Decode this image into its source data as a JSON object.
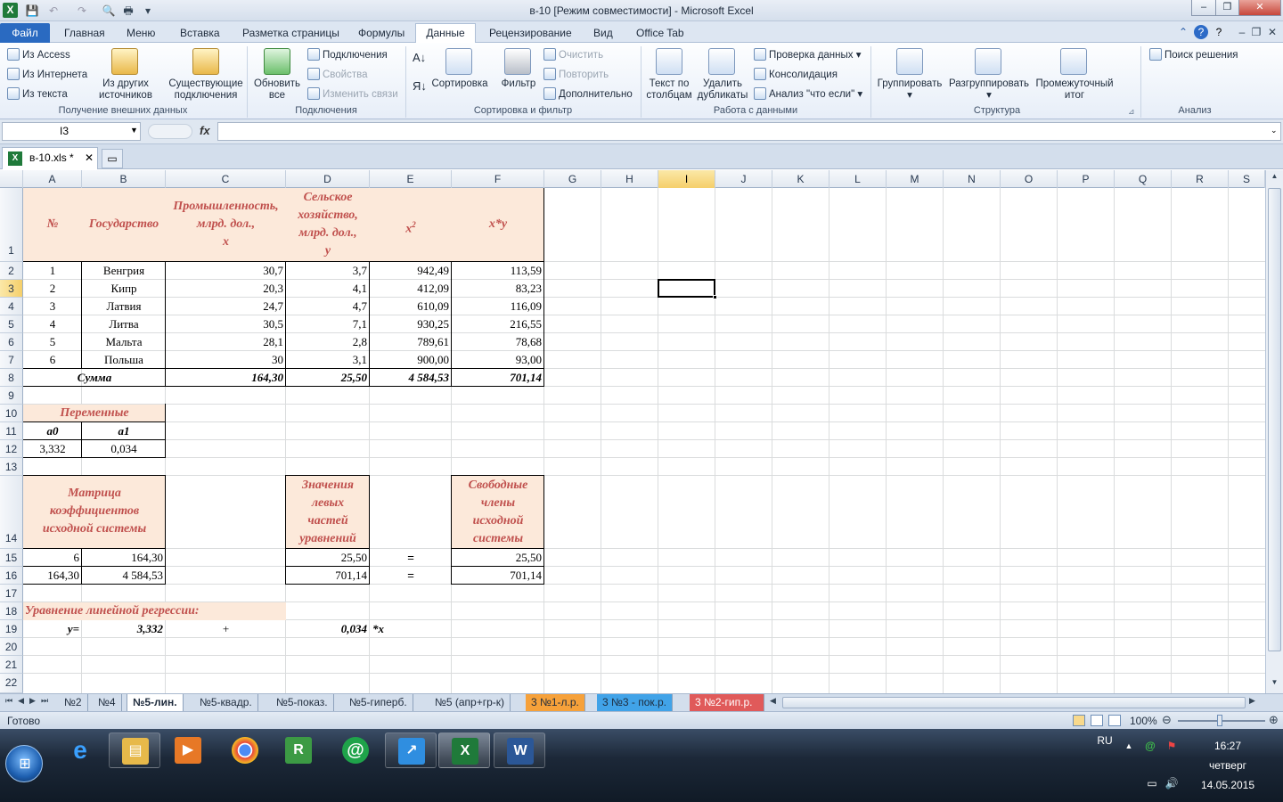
{
  "window": {
    "title": "в-10  [Режим совместимости]  -  Microsoft Excel",
    "minimize": "–",
    "restore": "❐",
    "close": "✕"
  },
  "menu_tabs": [
    "Файл",
    "Главная",
    "Меню",
    "Вставка",
    "Разметка страницы",
    "Формулы",
    "Данные",
    "Рецензирование",
    "Вид",
    "Office Tab"
  ],
  "ribbon": {
    "get_external": {
      "from_access": "Из Access",
      "from_web": "Из Интернета",
      "from_text": "Из текста",
      "from_other_1": "Из других",
      "from_other_2": "источников",
      "existing_1": "Существующие",
      "existing_2": "подключения",
      "label": "Получение внешних данных"
    },
    "connections": {
      "refresh_1": "Обновить",
      "refresh_2": "все",
      "connections": "Подключения",
      "properties": "Свойства",
      "edit_links": "Изменить связи",
      "label": "Подключения"
    },
    "sort_filter": {
      "sort": "Сортировка",
      "filter": "Фильтр",
      "clear": "Очистить",
      "reapply": "Повторить",
      "advanced": "Дополнительно",
      "label": "Сортировка и фильтр"
    },
    "data_tools": {
      "text_to_cols_1": "Текст по",
      "text_to_cols_2": "столбцам",
      "remove_dup_1": "Удалить",
      "remove_dup_2": "дубликаты",
      "validation": "Проверка данных",
      "consolidate": "Консолидация",
      "whatif": "Анализ \"что если\"",
      "label": "Работа с данными"
    },
    "outline": {
      "group": "Группировать",
      "ungroup": "Разгруппировать",
      "subtotal_1": "Промежуточный",
      "subtotal_2": "итог",
      "label": "Структура"
    },
    "analysis": {
      "solver": "Поиск решения",
      "label": "Анализ"
    }
  },
  "formula_bar": {
    "name_box": "I3",
    "fx": "fx",
    "value": ""
  },
  "workbook_tab": "в-10.xls *",
  "columns": [
    "A",
    "B",
    "C",
    "D",
    "E",
    "F",
    "G",
    "H",
    "I",
    "J",
    "K",
    "L",
    "M",
    "N",
    "O",
    "P",
    "Q",
    "R",
    "S"
  ],
  "rows": [
    "1",
    "2",
    "3",
    "4",
    "5",
    "6",
    "7",
    "8",
    "9",
    "10",
    "11",
    "12",
    "13",
    "14",
    "15",
    "16",
    "17",
    "18",
    "19",
    "20",
    "21",
    "22"
  ],
  "table": {
    "h_num": "№",
    "h_state": "Государство",
    "h_ind_1": "Промышленность,",
    "h_ind_2": "млрд. дол.,",
    "h_ind_3": "x",
    "h_agr_1": "Сельское",
    "h_agr_2": "хозяйство,",
    "h_agr_3": "млрд. дол.,",
    "h_agr_4": "y",
    "h_x2": "x",
    "h_x2_sup": "2",
    "h_xy": "x*y",
    "rows": [
      {
        "n": "1",
        "state": "Венгрия",
        "x": "30,7",
        "y": "3,7",
        "x2": "942,49",
        "xy": "113,59"
      },
      {
        "n": "2",
        "state": "Кипр",
        "x": "20,3",
        "y": "4,1",
        "x2": "412,09",
        "xy": "83,23"
      },
      {
        "n": "3",
        "state": "Латвия",
        "x": "24,7",
        "y": "4,7",
        "x2": "610,09",
        "xy": "116,09"
      },
      {
        "n": "4",
        "state": "Литва",
        "x": "30,5",
        "y": "7,1",
        "x2": "930,25",
        "xy": "216,55"
      },
      {
        "n": "5",
        "state": "Мальта",
        "x": "28,1",
        "y": "2,8",
        "x2": "789,61",
        "xy": "78,68"
      },
      {
        "n": "6",
        "state": "Польша",
        "x": "30",
        "y": "3,1",
        "x2": "900,00",
        "xy": "93,00"
      }
    ],
    "sum_label": "Сумма",
    "sum_x": "164,30",
    "sum_y": "25,50",
    "sum_x2": "4 584,53",
    "sum_xy": "701,14"
  },
  "variables": {
    "title": "Переменные",
    "a0_label": "a0",
    "a1_label": "a1",
    "a0": "3,332",
    "a1": "0,034"
  },
  "matrix": {
    "title_1": "Матрица",
    "title_2": "коэффициентов",
    "title_3": "исходной системы",
    "r1c1": "6",
    "r1c2": "164,30",
    "r2c1": "164,30",
    "r2c2": "4 584,53"
  },
  "left_values": {
    "title_1": "Значения",
    "title_2": "левых",
    "title_3": "частей",
    "title_4": "уравнений",
    "v1": "25,50",
    "v2": "701,14"
  },
  "eq_sign": "=",
  "free_terms": {
    "title_1": "Свободные",
    "title_2": "члены",
    "title_3": "исходной",
    "title_4": "системы",
    "v1": "25,50",
    "v2": "701,14"
  },
  "regression": {
    "title": "Уравнение линейной регрессии:",
    "y": "y=",
    "a0": "3,332",
    "plus": "+",
    "a1": "0,034",
    "x": "*x"
  },
  "sheet_tabs": [
    "№2",
    "№4",
    "№5-лин.",
    "№5-квадр.",
    "№5-показ.",
    "№5-гиперб.",
    "№5 (апр+гр-к)",
    "3 №1-л.р.",
    "3 №3 - пок.р.",
    "3 №2-гип.р."
  ],
  "status": {
    "ready": "Готово",
    "zoom": "100%"
  },
  "taskbar": {
    "lang": "RU",
    "time": "16:27",
    "day": "четверг",
    "date": "14.05.2015"
  },
  "colors": {
    "accent": "#2a6ac1",
    "header_fill": "#fce9da",
    "header_text": "#c0504d",
    "selection": "#f5cf6a"
  }
}
